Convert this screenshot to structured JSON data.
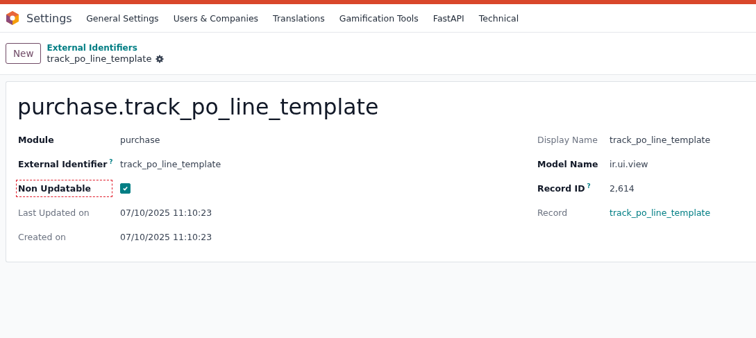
{
  "navbar": {
    "app": "Settings",
    "menu": [
      "General Settings",
      "Users & Companies",
      "Translations",
      "Gamification Tools",
      "FastAPI",
      "Technical"
    ]
  },
  "control_panel": {
    "new_button": "New",
    "breadcrumb": "External Identifiers",
    "record": "track_po_line_template"
  },
  "form": {
    "title": "purchase.track_po_line_template",
    "left_fields": [
      {
        "label": "Module",
        "emphasized": true,
        "kind": "text",
        "value": "purchase",
        "highlighted": false
      },
      {
        "label": "External Identifier",
        "help": "?",
        "emphasized": true,
        "kind": "text",
        "value": "track_po_line_template",
        "highlighted": false
      },
      {
        "label": "Non Updatable",
        "emphasized": true,
        "kind": "checkbox",
        "checked": true,
        "highlighted": true
      },
      {
        "label": "Last Updated on",
        "emphasized": false,
        "kind": "text",
        "value": "07/10/2025 11:10:23",
        "highlighted": false
      },
      {
        "label": "Created on",
        "emphasized": false,
        "kind": "text",
        "value": "07/10/2025 11:10:23",
        "highlighted": false
      }
    ],
    "right_fields": [
      {
        "label": "Display Name",
        "emphasized": false,
        "kind": "text",
        "value": "track_po_line_template",
        "highlighted": false
      },
      {
        "label": "Model Name",
        "emphasized": true,
        "kind": "text",
        "value": "ir.ui.view",
        "highlighted": false
      },
      {
        "label": "Record ID",
        "help": "?",
        "emphasized": true,
        "kind": "text",
        "value": "2,614",
        "highlighted": false
      },
      {
        "label": "Record",
        "emphasized": false,
        "kind": "link",
        "value": "track_po_line_template",
        "highlighted": false
      }
    ]
  }
}
